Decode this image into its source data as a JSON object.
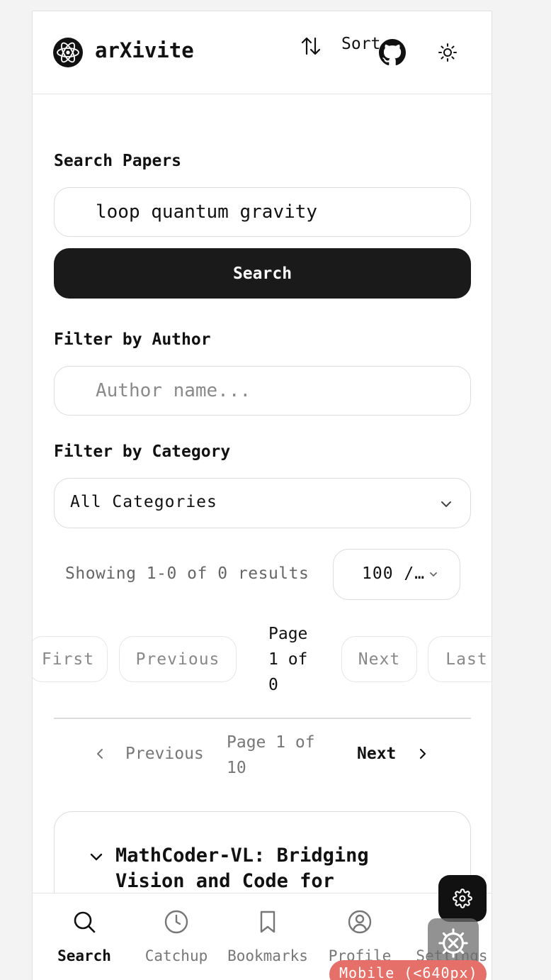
{
  "app": {
    "name": "arXivite"
  },
  "header": {
    "sort_label": "Sort"
  },
  "search": {
    "label": "Search Papers",
    "value": "loop quantum gravity",
    "button_label": "Search"
  },
  "author_filter": {
    "label": "Filter by Author",
    "placeholder": "Author name..."
  },
  "category_filter": {
    "label": "Filter by Category",
    "selected": "All Categories"
  },
  "results": {
    "showing_text": "Showing 1-0 of 0 results",
    "per_page": "100 /…"
  },
  "pagination_top": {
    "first": "First",
    "previous": "Previous",
    "page_line1": "Page",
    "page_line2": "1 of",
    "page_line3": "0",
    "next": "Next",
    "last": "Last"
  },
  "pagination_bottom": {
    "previous": "Previous",
    "page_info_line1": "Page 1 of",
    "page_info_line2": "10",
    "next": "Next"
  },
  "paper_card": {
    "title": "MathCoder-VL: Bridging Vision and Code for"
  },
  "bottom_nav": [
    {
      "label": "Search",
      "icon": "search-icon",
      "active": true
    },
    {
      "label": "Catchup",
      "icon": "clock-icon"
    },
    {
      "label": "Bookmarks",
      "icon": "bookmark-icon"
    },
    {
      "label": "Profile",
      "icon": "user-circle-icon"
    },
    {
      "label": "Settings",
      "icon": "settings-icon"
    }
  ],
  "debug_badge": "Mobile (<640px)",
  "colors": {
    "primary": "#1a1a1a",
    "border": "#dcdcdc",
    "muted": "#777777",
    "badge": "#e57069"
  }
}
